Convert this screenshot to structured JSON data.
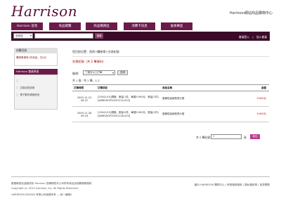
{
  "header": {
    "logo_text": "Harrison",
    "site_label": "Harrison網站商品購物中心"
  },
  "nav": {
    "tabs": [
      "Harrison 首頁",
      "商品總覽",
      "商品購買區",
      "消費卡訊息",
      "會員專區"
    ]
  },
  "search": {
    "select_value": "全商品",
    "button_label": "搜尋",
    "links": [
      "會員登入",
      "|",
      "加入會員"
    ]
  },
  "sidebar": {
    "box1_title": "快購目錄",
    "box1_link": "購物車裡有1件商品，共0元",
    "box2_title": "Harrison 會員專區",
    "items": [
      "",
      "交易紀錄查詢",
      "電子郵件帳號修改"
    ]
  },
  "main": {
    "breadcrumb": "您目前位置：首頁>購物車>交易紀錄",
    "section_title": "交易紀錄（共 2 筆資料）",
    "query_label": "檢視：",
    "query_select": "三個月以上訂單",
    "query_button": "查詢",
    "summary": "共 1 頁／共 2 筆，1-2",
    "table": {
      "headers": [
        "訂購時間",
        "訂購項目",
        "商品名稱",
        "金額"
      ],
      "rows": [
        {
          "time": "2009-12-10 08:22",
          "detail": "[20041/15]規格，數量:1件，單價9,900元，數量(1件) [WEBSHOP20091210-003]",
          "name": "諾爾哲曲線型長沙發",
          "price": "9,900元"
        },
        {
          "time": "2009-11-26 09:16",
          "detail": "[20041/15]規格，數量:0件，單價9,900元，數量(1件) [WEBSHOP20091126-003]",
          "name": "諾爾哲曲線型長沙發",
          "price": "9,900元"
        }
      ]
    },
    "pager": {
      "label": "共 2 筆紀錄：",
      "input_value": "1",
      "unit": "頁",
      "button": "前往"
    }
  },
  "footer": {
    "lines": [
      "郵撥帳號及金融資訊 Harrison 官網銷售本公司所有商品及相關服務條款",
      "Copyright (c) 2012 Harrison, Inc. All Rights Reserved.",
      "HARRISON DESIGN 有限公司版權所有 — 統一編號0"
    ],
    "right_text": "國內 HARRISON 購物中心 | 會員服務條款 | 隱私權政策 | 常見問題"
  },
  "colors": {
    "brand": "#6b1a4a",
    "search_bar": "#3a0b28",
    "accent": "#c03a8e",
    "price": "#cc0000"
  }
}
